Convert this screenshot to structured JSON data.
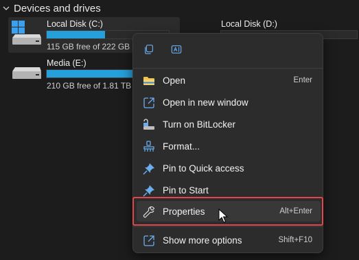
{
  "section": {
    "title": "Devices and drives"
  },
  "drives": [
    {
      "name": "Local Disk (C:)",
      "free_text": "115 GB free of 222 GB",
      "used_fraction": 0.48,
      "selected": true,
      "icon": "windows-drive-icon"
    },
    {
      "name": "Local Disk (D:)",
      "free_text": "",
      "used_fraction": null,
      "selected": false,
      "icon": "drive-icon"
    },
    {
      "name": "Media (E:)",
      "free_text": "210 GB free of 1.81 TB",
      "used_fraction": 0.89,
      "selected": false,
      "icon": "drive-icon"
    }
  ],
  "context_menu": {
    "quick_actions": [
      {
        "icon": "copy-icon"
      },
      {
        "icon": "rename-icon"
      }
    ],
    "items": [
      {
        "label": "Open",
        "shortcut": "Enter",
        "icon": "folder-open-icon"
      },
      {
        "label": "Open in new window",
        "shortcut": "",
        "icon": "open-new-window-icon"
      },
      {
        "label": "Turn on BitLocker",
        "shortcut": "",
        "icon": "bitlocker-icon"
      },
      {
        "label": "Format...",
        "shortcut": "",
        "icon": "format-icon"
      },
      {
        "label": "Pin to Quick access",
        "shortcut": "",
        "icon": "pin-icon"
      },
      {
        "label": "Pin to Start",
        "shortcut": "",
        "icon": "pin-icon"
      },
      {
        "label": "Properties",
        "shortcut": "Alt+Enter",
        "icon": "wrench-icon",
        "hovered": true
      },
      {
        "label": "Show more options",
        "shortcut": "Shift+F10",
        "icon": "show-more-options-icon"
      }
    ]
  },
  "colors": {
    "background": "#1c1c1c",
    "menu_background": "#2c2c2c",
    "usage_bar": "#26a0da",
    "highlight_border": "#e0464a",
    "folder_yellow": "#f2c14e",
    "icon_blue": "#5ba0ea"
  }
}
